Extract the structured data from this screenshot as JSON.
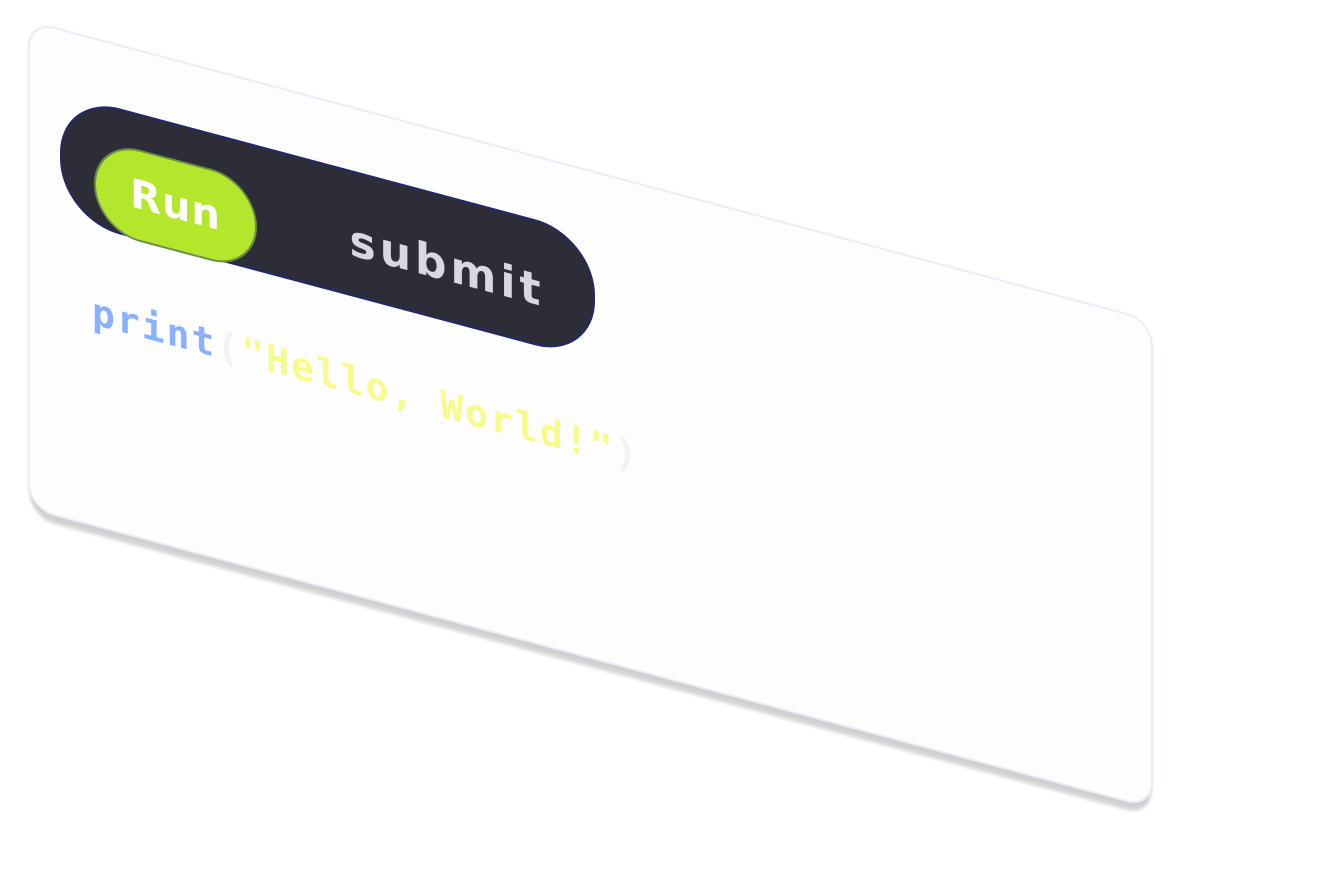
{
  "toolbar": {
    "run_label": "Run",
    "submit_label": "submit"
  },
  "code": {
    "function": "print",
    "open_paren": "(",
    "string": "\"Hello, World!\"",
    "close_paren": ")"
  },
  "colors": {
    "run_accent": "#b4e62b",
    "toggle_background": "#2d2d38",
    "function_token": "#8ab1ff",
    "string_token": "#f7fb8a"
  }
}
